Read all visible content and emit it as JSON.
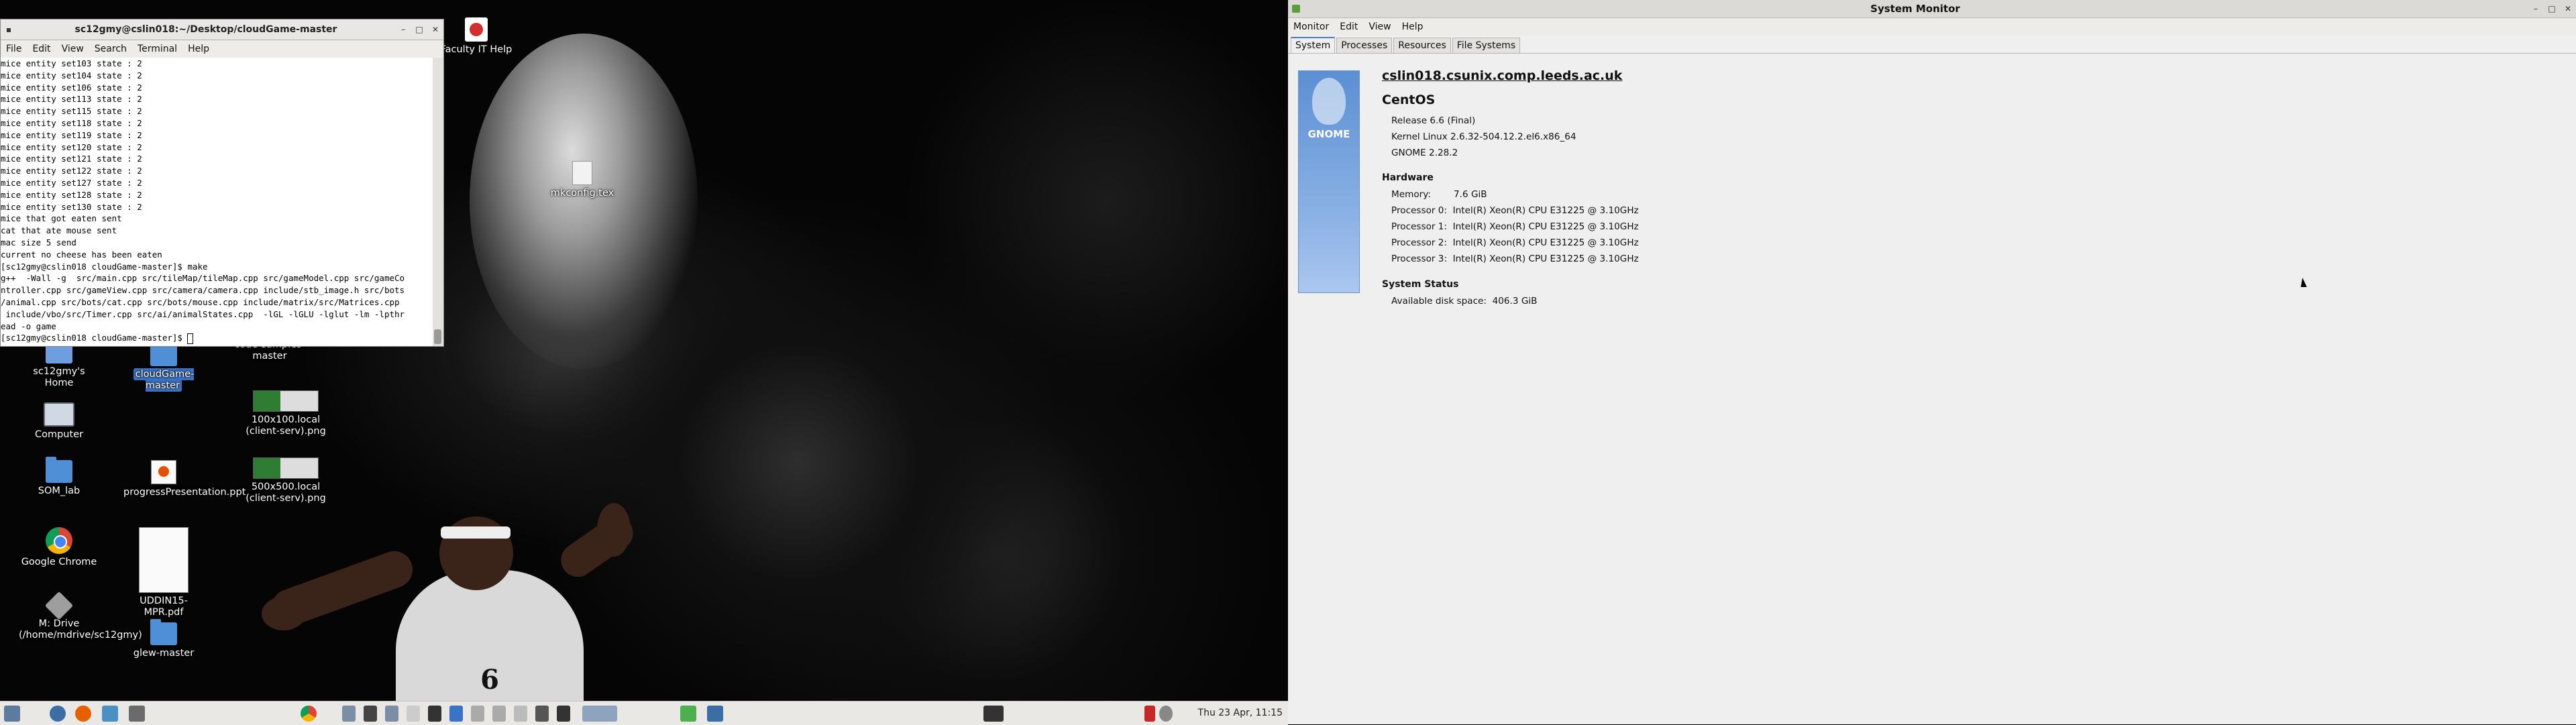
{
  "terminal": {
    "title": "sc12gmy@cslin018:~/Desktop/cloudGame-master",
    "menu": [
      "File",
      "Edit",
      "View",
      "Search",
      "Terminal",
      "Help"
    ],
    "lines": [
      "mice entity set103 state : 2",
      "mice entity set104 state : 2",
      "mice entity set106 state : 2",
      "mice entity set113 state : 2",
      "mice entity set115 state : 2",
      "mice entity set118 state : 2",
      "mice entity set119 state : 2",
      "mice entity set120 state : 2",
      "mice entity set121 state : 2",
      "mice entity set122 state : 2",
      "mice entity set127 state : 2",
      "mice entity set128 state : 2",
      "mice entity set130 state : 2",
      "mice that got eaten sent",
      "cat that ate mouse sent",
      "mac size 5 send",
      "current no cheese has been eaten",
      "[sc12gmy@cslin018 cloudGame-master]$ make",
      "g++  -Wall -g  src/main.cpp src/tileMap/tileMap.cpp src/gameModel.cpp src/gameCo",
      "ntroller.cpp src/gameView.cpp src/camera/camera.cpp include/stb_image.h src/bots",
      "/animal.cpp src/bots/cat.cpp src/bots/mouse.cpp include/matrix/src/Matrices.cpp",
      " include/vbo/src/Timer.cpp src/ai/animalStates.cpp  -lGL -lGLU -lglut -lm -lpthr",
      "ead -o game"
    ],
    "prompt": "[sc12gmy@cslin018 cloudGame-master]$ "
  },
  "desktop": {
    "icons": {
      "faculty_it_help": "Faculty IT Help",
      "mkconfig": "mkconfig.tex",
      "home": "sc12gmy's Home",
      "cloudgame": "cloudGame-master",
      "code_samples": "code-samples-master",
      "computer": "Computer",
      "img100": "100x100.local (client-serv).png",
      "som_lab": "SOM_lab",
      "progress": "progressPresentation.ppt",
      "img500": "500x500.local (client-serv).png",
      "chrome": "Google Chrome",
      "uddin": "UDDIN15-MPR.pdf",
      "mdrive": "M: Drive (/home/mdrive/sc12gmy)",
      "glew": "glew-master"
    },
    "jersey_number": "6"
  },
  "taskbar": {
    "clock": "Thu 23 Apr, 11:15"
  },
  "system_monitor": {
    "window_title": "System Monitor",
    "menu": [
      "Monitor",
      "Edit",
      "View",
      "Help"
    ],
    "tabs": [
      "System",
      "Processes",
      "Resources",
      "File Systems"
    ],
    "active_tab": "System",
    "logo_text": "GNOME",
    "hostname": "cslin018.csunix.comp.leeds.ac.uk",
    "os_name": "CentOS",
    "release": "Release 6.6 (Final)",
    "kernel": "Kernel Linux 2.6.32-504.12.2.el6.x86_64",
    "gnome": "GNOME 2.28.2",
    "hardware_heading": "Hardware",
    "memory_label": "Memory:",
    "memory_value": "7.6 GiB",
    "processors": [
      "Processor 0:  Intel(R) Xeon(R) CPU E31225 @ 3.10GHz",
      "Processor 1:  Intel(R) Xeon(R) CPU E31225 @ 3.10GHz",
      "Processor 2:  Intel(R) Xeon(R) CPU E31225 @ 3.10GHz",
      "Processor 3:  Intel(R) Xeon(R) CPU E31225 @ 3.10GHz"
    ],
    "status_heading": "System Status",
    "disk_space": "Available disk space:  406.3 GiB"
  }
}
